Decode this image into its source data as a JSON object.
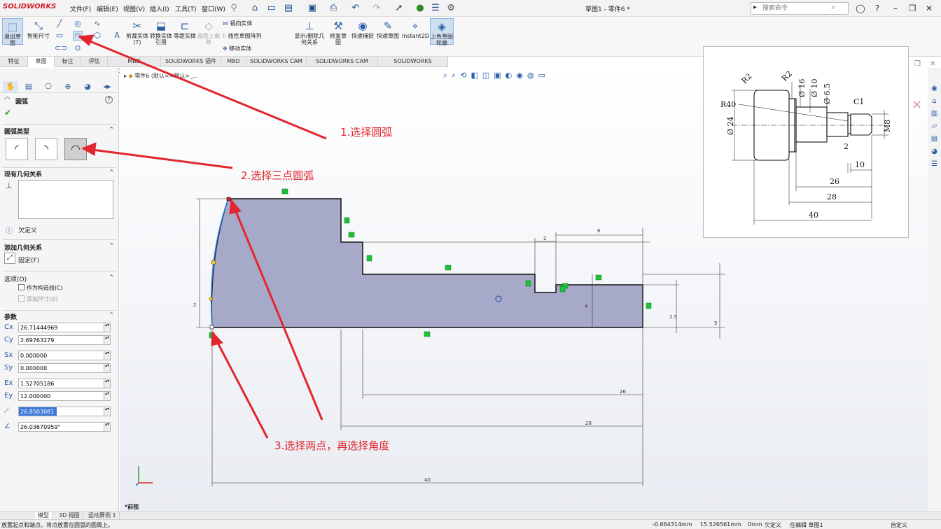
{
  "titlebar": {
    "logo": "SOLIDWORKS",
    "menus": [
      "文件(F)",
      "编辑(E)",
      "视图(V)",
      "插入(I)",
      "工具(T)",
      "窗口(W)"
    ],
    "doc_title": "草图1 - 零件6 *",
    "search_placeholder": "搜索命令"
  },
  "ribbon": {
    "exit_sketch": "退出草图",
    "smart_dim": "智能尺寸",
    "trim": "剪裁实体(T)",
    "convert": "转换实体引用",
    "offset": "等距实体",
    "surface_offset": "曲面上偏移",
    "mirror": "镜向实体",
    "linear_pattern": "线性草图阵列",
    "move": "移动实体",
    "show_relations": "显示/删除几何关系",
    "repair": "修复草图",
    "quick_snap": "快速捕捉",
    "rapid_sketch": "快速草图",
    "instant2d": "Instant2D",
    "shaded": "上色草图轮廓"
  },
  "tabs": [
    "特征",
    "草图",
    "标注",
    "评估",
    "MBD Dimensions",
    "SOLIDWORKS 插件",
    "MBD",
    "SOLIDWORKS CAM",
    "SOLIDWORKS CAM TBM",
    "SOLIDWORKS Inspection"
  ],
  "panel": {
    "title": "圆弧",
    "arc_type_title": "圆弧类型",
    "existing_rel_title": "现有几何关系",
    "under_defined": "欠定义",
    "add_rel_title": "添加几何关系",
    "fix": "固定(F)",
    "options_title": "选项(O)",
    "construction": "作为构造线(C)",
    "add_dims": "添加尺寸(D)",
    "params_title": "参数",
    "params": [
      "26.71444969",
      "2.69763279",
      "0.000000",
      "0.000000",
      "1.52705186",
      "12.000000",
      "26.8503081",
      "26.03670959°"
    ]
  },
  "tree": {
    "part": "零件6 (默认<<默认>_..."
  },
  "sketch_dims": [
    "2",
    "2",
    "6",
    "26",
    "28",
    "40",
    "4",
    "5",
    "2.5"
  ],
  "ref_drawing": {
    "labels": [
      "R2",
      "R2",
      "Ø 16",
      "Ø 10",
      "Ø 6.5",
      "C1",
      "R40",
      "Ø 24",
      "M8",
      "2",
      "10",
      "26",
      "28",
      "40"
    ]
  },
  "annotations": [
    "1.选择圆弧",
    "2.选择三点圆弧",
    "3.选择两点，再选择角度"
  ],
  "view_label": "*前视",
  "bottom_tabs": [
    "模型",
    "3D 视图",
    "运动算例 1"
  ],
  "status": {
    "hint": "放置起点和端点。将点放置在圆弧的圆周上。",
    "x": "-0.664314mm",
    "y": "15.526561mm",
    "z": "0mm",
    "defined": "欠定义",
    "editing": "在编辑 草图1",
    "units": "自定义"
  }
}
